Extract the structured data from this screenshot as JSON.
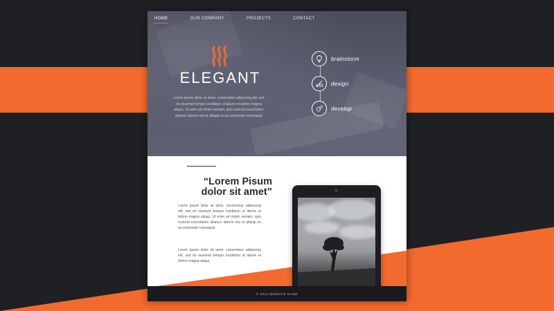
{
  "nav": {
    "items": [
      {
        "label": "HOME",
        "active": true
      },
      {
        "label": "OUR COMPANY",
        "active": false
      },
      {
        "label": "PROJECTS",
        "active": false
      },
      {
        "label": "CONTACT",
        "active": false
      }
    ]
  },
  "hero": {
    "logo_icon": "flame-waves-icon",
    "title": "ELEGANT",
    "text": "Lorem ipsum dolor sit amet, consectetur adipiscing elit, sed do eiusmod tempor incididunt ut labore et dolore magna aliqua. Ut enim ad minim veniam, quis nostrud exercitation ullamco laboris nisi ut aliquip ex ea commodo consequat."
  },
  "process": [
    {
      "label": "brainstorm",
      "icon": "lightbulb-icon"
    },
    {
      "label": "design",
      "icon": "pencil-ruler-icon"
    },
    {
      "label": "develop",
      "icon": "gears-icon"
    }
  ],
  "content": {
    "quote_title_1": "“Lorem Pisum",
    "quote_title_2": "dolor sit amet”",
    "paragraph_1": "Lorem ipsum dolor sit amet, consectetur adipiscing elit, sed do eiusmod tempor incididunt ut labore et dolore magna aliqua. Ut enim ad minim veniam, quis nostrud exercitation ullamco laboris nisi ut aliquip ex ea commodo consequat.",
    "paragraph_2": "Lorem ipsum dolor sit amet, consectetur adipiscing elit, sed do eiusmod tempor incididunt ut labore et dolore magna aliqua."
  },
  "footer": {
    "text": "© 2014 WEBSITE NAME"
  },
  "colors": {
    "accent": "#f26a2e",
    "background": "#1f2023",
    "hero": "#585a6b"
  }
}
